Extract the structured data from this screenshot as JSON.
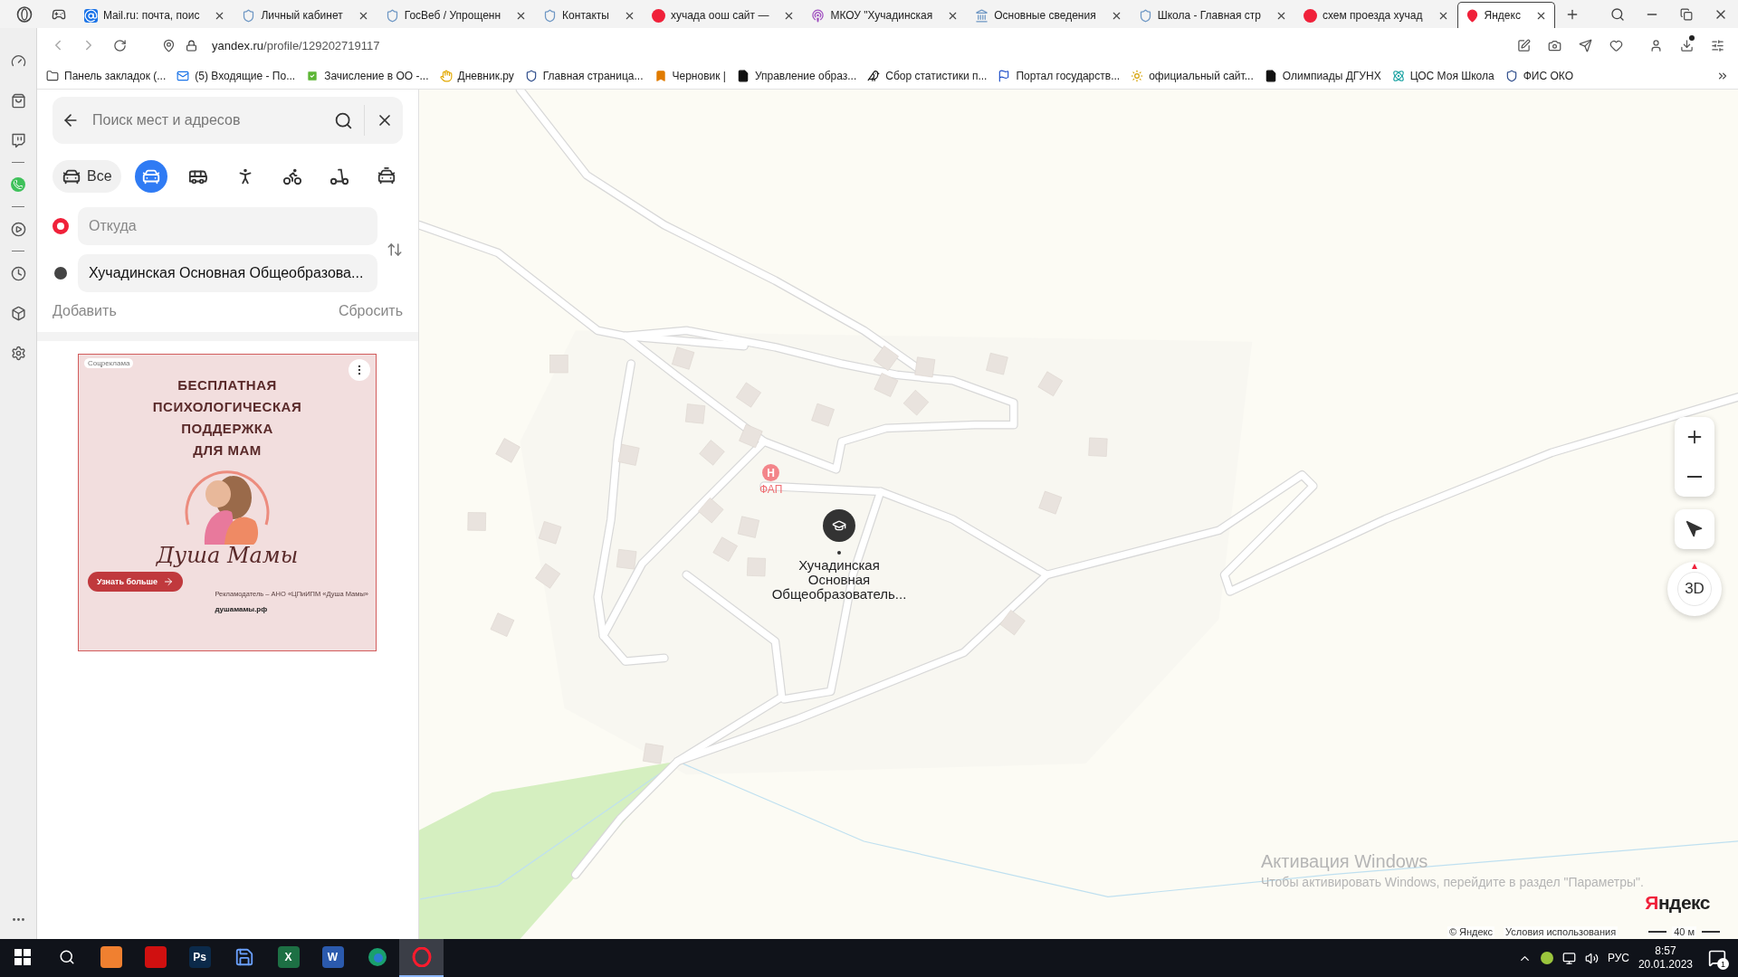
{
  "browser": {
    "tabs": [
      {
        "kind": "mail",
        "title": "Mail.ru: почта, поис",
        "selected": false
      },
      {
        "kind": "emblem",
        "title": "Личный кабинет",
        "selected": false
      },
      {
        "kind": "emblem",
        "title": "ГосВеб / Упрощенн",
        "selected": false
      },
      {
        "kind": "emblem",
        "title": "Контакты",
        "selected": false
      },
      {
        "kind": "yandex",
        "title": "хучада оош сайт —",
        "selected": false
      },
      {
        "kind": "radio",
        "title": "МКОУ \"Хучадинская",
        "selected": false
      },
      {
        "kind": "building",
        "title": "Основные сведения",
        "selected": false
      },
      {
        "kind": "emblem",
        "title": "Школа - Главная стр",
        "selected": false
      },
      {
        "kind": "yandex",
        "title": "схем проезда хучад",
        "selected": false
      },
      {
        "kind": "maps",
        "title": "Яндекс",
        "selected": true
      }
    ],
    "address": {
      "domain": "yandex.ru",
      "path": "/profile/129202719117"
    },
    "bookmarks": [
      {
        "kind": "folder",
        "title": "Панель закладок (..."
      },
      {
        "kind": "mail",
        "title": "(5) Входящие - По..."
      },
      {
        "kind": "check",
        "title": "Зачисление в ОО -..."
      },
      {
        "kind": "hand",
        "title": "Дневник.ру"
      },
      {
        "kind": "shield",
        "title": "Главная страница..."
      },
      {
        "kind": "draft",
        "title": "Черновик |"
      },
      {
        "kind": "file",
        "title": "Управление образ..."
      },
      {
        "kind": "bird",
        "title": "Сбор статистики п..."
      },
      {
        "kind": "flag",
        "title": "Портал государств..."
      },
      {
        "kind": "sun",
        "title": "официальный сайт..."
      },
      {
        "kind": "file",
        "title": "Олимпиады ДГУНХ"
      },
      {
        "kind": "atom",
        "title": "ЦОС Моя Школа"
      },
      {
        "kind": "shield",
        "title": "ФИС ОКО"
      }
    ]
  },
  "route_panel": {
    "search_placeholder": "Поиск мест и адресов",
    "modes": [
      {
        "kind": "all",
        "label": "Все",
        "selected": false
      },
      {
        "kind": "car",
        "selected": true
      },
      {
        "kind": "bus",
        "selected": false
      },
      {
        "kind": "walk",
        "selected": false
      },
      {
        "kind": "bike",
        "selected": false
      },
      {
        "kind": "scooter",
        "selected": false
      },
      {
        "kind": "taxi",
        "selected": false
      }
    ],
    "from_placeholder": "Откуда",
    "to_value": "Хучадинская Основная Общеобразова...",
    "add": "Добавить",
    "reset": "Сбросить"
  },
  "ad": {
    "tag": "Соцреклама",
    "headline": [
      "БЕСПЛАТНАЯ",
      "ПСИХОЛОГИЧЕСКАЯ",
      "ПОДДЕРЖКА",
      "ДЛЯ МАМ"
    ],
    "brand": "Душа Мамы",
    "button": "Узнать больше",
    "advertiser": "Рекламодатель – АНО «ЦПиИПМ «Душа Мамы»",
    "site": "душамамы.рф"
  },
  "map": {
    "pois": [
      {
        "icon_letter": "Н",
        "label": "ФАП"
      }
    ],
    "school_label": "Хучадинская Основная Общеобразователь...",
    "three_d": "3D",
    "logo": "Яндекс",
    "copyright": "© Яндекс",
    "terms": "Условия использования",
    "scale": "40 м"
  },
  "windows_activation": {
    "title": "Активация Windows",
    "text": "Чтобы активировать Windows, перейдите в раздел \"Параметры\"."
  },
  "taskbar": {
    "apps": [
      {
        "kind": "yandex",
        "selected": false
      },
      {
        "kind": "red",
        "selected": false
      },
      {
        "kind": "ps",
        "glyph": "Ps",
        "selected": false
      },
      {
        "kind": "save",
        "selected": false
      },
      {
        "kind": "excel",
        "glyph": "X",
        "selected": false
      },
      {
        "kind": "word",
        "glyph": "W",
        "selected": false
      },
      {
        "kind": "edge",
        "selected": false
      },
      {
        "kind": "opera",
        "selected": true
      }
    ],
    "language": "РУС",
    "time": "8:57",
    "date": "20.01.2023",
    "notifications": "1"
  }
}
